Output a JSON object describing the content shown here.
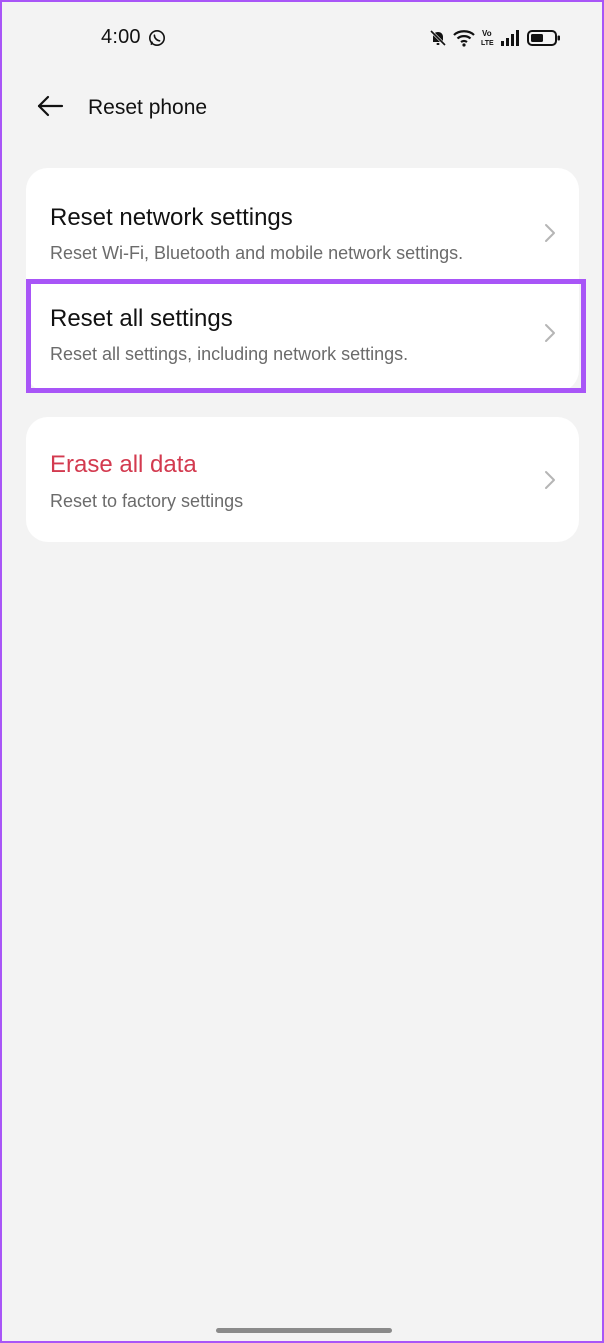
{
  "status_bar": {
    "time": "4:00",
    "icons": [
      "whatsapp-icon",
      "bell-off-icon",
      "wifi-icon",
      "volte-icon",
      "signal-icon",
      "battery-icon"
    ]
  },
  "header": {
    "title": "Reset phone",
    "back_icon": "arrow-left-icon"
  },
  "options": {
    "network": {
      "title": "Reset network settings",
      "subtitle": "Reset Wi-Fi, Bluetooth and mobile network settings."
    },
    "all_settings": {
      "title": "Reset all settings",
      "subtitle": "Reset all settings, including network settings.",
      "highlighted": true
    },
    "erase": {
      "title": "Erase all data",
      "subtitle": "Reset to factory settings"
    }
  },
  "colors": {
    "background": "#f3f3f3",
    "card": "#ffffff",
    "highlight": "#a855f7",
    "danger_text": "#d33a4f",
    "subtitle_text": "#6b6b6b"
  }
}
